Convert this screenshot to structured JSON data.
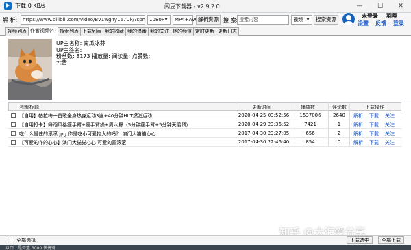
{
  "window": {
    "speed": "下载:0 KB/s",
    "title": "闪豆下载器 - v2.9.2.0",
    "minimize_glyph": "—",
    "maximize_glyph": "☐",
    "close_glyph": "✕"
  },
  "url_row": {
    "label": "解 析:",
    "url_value": "https://www.bilibili.com/video/BV1wg4y167Uk/?spm_id_f",
    "quality": "1080P",
    "format": "MP4+AVC",
    "parse_button": "解析资源",
    "search_label": "搜 索:",
    "search_placeholder": "搜索内容",
    "search_type": "视频",
    "search_button": "搜索资源"
  },
  "user": {
    "status": "未登录",
    "name": "羽翔",
    "links": [
      "设置",
      "反馈",
      "登录"
    ]
  },
  "tabs": [
    "视频列表",
    "作者视频(4)",
    "搜索列表",
    "下载列表",
    "我的收藏",
    "我的追番",
    "我的关注",
    "他的频道",
    "定时更新",
    "更新日志"
  ],
  "active_tab_index": 1,
  "author": {
    "name_line": "UP主名称: 南瓜冰芬",
    "sign_line": "UP主签名:",
    "stats_line": "粉丝数: 8173   播放量:      阅读量:      点赞数:",
    "notice_line": "公告:"
  },
  "table": {
    "headers": [
      "视频标题",
      "更新时间",
      "播放数",
      "评论数",
      "下载操作"
    ],
    "op_labels": [
      "解析",
      "下载",
      "关注"
    ],
    "rows": [
      {
        "title": "【自用】帕拉梅一首歌全身热身运动3遍+40分钟HIIT燃脂运动",
        "date": "2020-04-25 03:52:56",
        "plays": "1537006",
        "comments": "2640"
      },
      {
        "title": "【自用打卡】舞蹈风格瘦手臂+瘦手臂操+周六野（5分钟瘦手臂+5分钟天鹅颈）",
        "date": "2020-04-29 23:36:52",
        "plays": "7421",
        "comments": "1"
      },
      {
        "title": "吃什么慢住的滚滚.jpg 你是吃小可爱抱大的吗？ 演门大猫猫心心",
        "date": "2017-04-30 23:27:05",
        "plays": "656",
        "comments": "2"
      },
      {
        "title": "【可爱的咋的心心】演门大猫猫心心  可爱的圆滚滚",
        "date": "2017-04-30 22:46:40",
        "plays": "854",
        "comments": "0"
      }
    ]
  },
  "bottom": {
    "select_all": "全部选择",
    "download_selected": "下载选中",
    "download_all": "全部下载"
  },
  "taskbar_text": "以口：是否重 3000 快捷键",
  "watermark": "知乎 @大海爱分享"
}
